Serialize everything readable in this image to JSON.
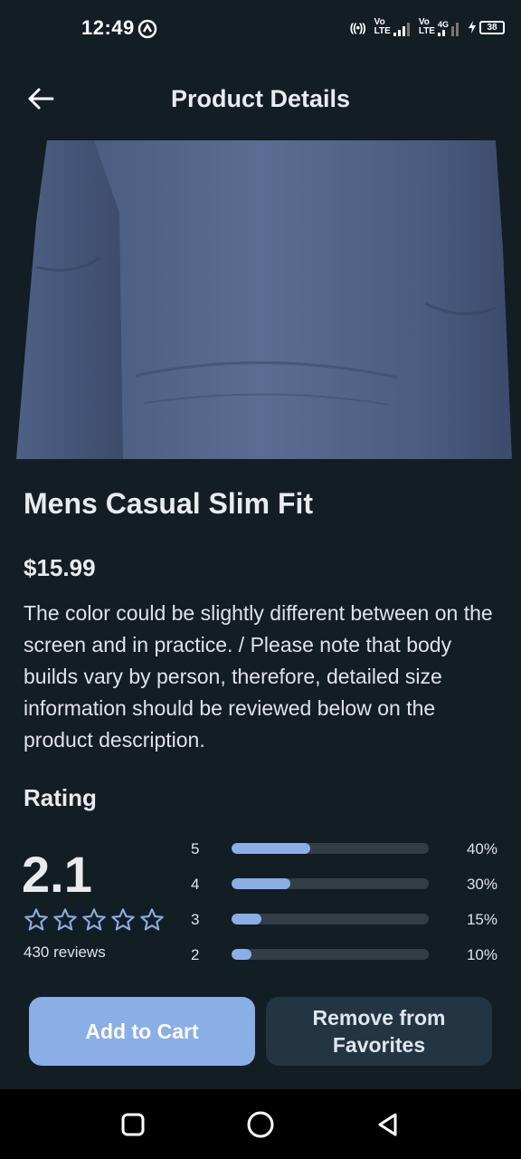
{
  "status_bar": {
    "time": "12:49",
    "net1": [
      "Vo",
      "LTE"
    ],
    "net2_top": "4G",
    "net2": [
      "Vo",
      "LTE"
    ],
    "battery": "38",
    "battery_icon": "charging-bolt"
  },
  "app_bar": {
    "title": "Product Details",
    "back_icon": "arrow-left"
  },
  "product": {
    "name": "Mens Casual Slim Fit",
    "price": "$15.99",
    "description": "The color could be slightly different between on the screen and in practice. / Please note that body builds vary by person, therefore, detailed size information should be reviewed below on the product description."
  },
  "rating": {
    "heading": "Rating",
    "value": "2.1",
    "stars_total": 5,
    "stars_filled": 0,
    "review_count": "430 reviews",
    "distribution": [
      {
        "star": "5",
        "percent": "40%",
        "fill": 0.4
      },
      {
        "star": "4",
        "percent": "30%",
        "fill": 0.3
      },
      {
        "star": "3",
        "percent": "15%",
        "fill": 0.15
      },
      {
        "star": "2",
        "percent": "10%",
        "fill": 0.1
      }
    ]
  },
  "actions": {
    "add_to_cart": "Add to Cart",
    "remove_favorites_line1": "Remove from",
    "remove_favorites_line2": "Favorites"
  },
  "colors": {
    "background": "#131d24",
    "accent": "#8aaee6",
    "secondary_button": "#233442",
    "track": "#333d45"
  }
}
